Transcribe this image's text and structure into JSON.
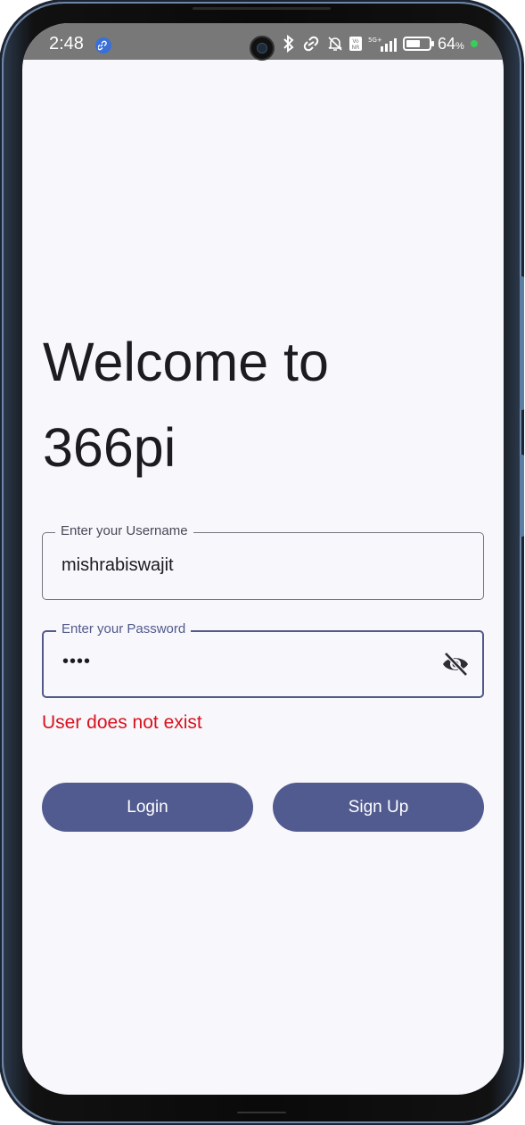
{
  "status_bar": {
    "time": "2:48",
    "battery_percent": "64",
    "battery_unit": "%",
    "battery_level": 0.64
  },
  "login": {
    "title_line1": "Welcome to",
    "title_line2": "366pi",
    "username_label": "Enter your Username",
    "username_value": "mishrabiswajit",
    "password_label": "Enter your Password",
    "password_value": "••••",
    "error_message": "User does not exist",
    "login_label": "Login",
    "signup_label": "Sign Up"
  },
  "colors": {
    "primary": "#525b8f",
    "error": "#d9121c",
    "background": "#f8f7fc",
    "status_bar": "#787878"
  },
  "icons": {
    "password_toggle": "visibility-off-icon"
  }
}
